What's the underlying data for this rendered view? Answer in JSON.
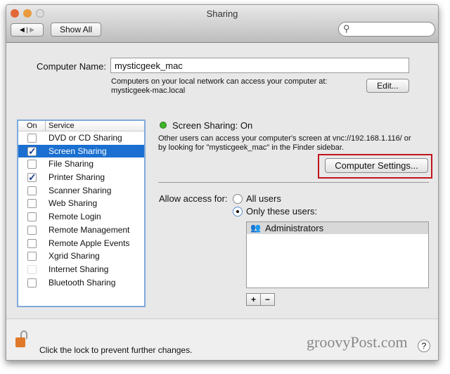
{
  "window": {
    "title": "Sharing"
  },
  "toolbar": {
    "show_all": "Show All",
    "search_placeholder": ""
  },
  "computer_name": {
    "label": "Computer Name:",
    "value": "mysticgeek_mac",
    "info_line1": "Computers on your local network can access your computer at:",
    "info_line2": "mysticgeek-mac.local",
    "edit": "Edit..."
  },
  "services": {
    "col_on": "On",
    "col_service": "Service",
    "items": [
      {
        "label": "DVD or CD Sharing",
        "checked": false
      },
      {
        "label": "Screen Sharing",
        "checked": true,
        "selected": true
      },
      {
        "label": "File Sharing",
        "checked": false
      },
      {
        "label": "Printer Sharing",
        "checked": true
      },
      {
        "label": "Scanner Sharing",
        "checked": false
      },
      {
        "label": "Web Sharing",
        "checked": false
      },
      {
        "label": "Remote Login",
        "checked": false
      },
      {
        "label": "Remote Management",
        "checked": false
      },
      {
        "label": "Remote Apple Events",
        "checked": false
      },
      {
        "label": "Xgrid Sharing",
        "checked": false
      },
      {
        "label": "Internet Sharing",
        "checked": false,
        "disabled": true
      },
      {
        "label": "Bluetooth Sharing",
        "checked": false
      }
    ]
  },
  "detail": {
    "status": "Screen Sharing: On",
    "status_color": "#3fb52a",
    "desc1": "Other users can access your computer's screen at vnc://192.168.1.116/ or",
    "desc2": "by looking for \"mysticgeek_mac\" in the Finder sidebar.",
    "computer_settings": "Computer Settings...",
    "highlight_color": "#c0141c",
    "allow_label": "Allow access for:",
    "opt_all": "All users",
    "opt_only": "Only these users:",
    "selected_option": "Only these users:",
    "users": [
      "Administrators"
    ],
    "add": "+",
    "remove": "−"
  },
  "footer": {
    "lock_text": "Click the lock to prevent further changes.",
    "help": "?",
    "watermark": "groovyPost.com"
  }
}
